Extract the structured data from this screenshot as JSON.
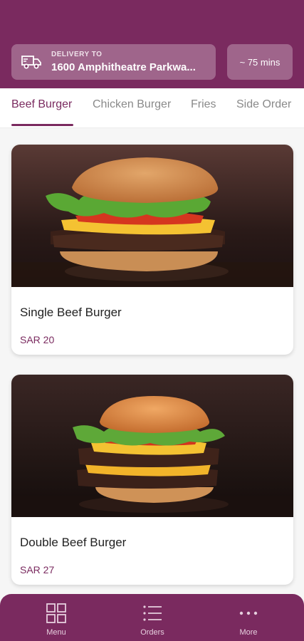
{
  "header": {
    "delivery_label": "DELIVERY TO",
    "delivery_address": "1600 Amphitheatre Parkwa...",
    "eta": "~ 75 mins",
    "icon": "truck-icon"
  },
  "tabs": [
    {
      "label": "Beef Burger",
      "active": true
    },
    {
      "label": "Chicken Burger",
      "active": false
    },
    {
      "label": "Fries",
      "active": false
    },
    {
      "label": "Side Order",
      "active": false
    }
  ],
  "products": [
    {
      "name": "Single Beef Burger",
      "price": "SAR 20"
    },
    {
      "name": "Double Beef Burger",
      "price": "SAR 27"
    }
  ],
  "bottom_nav": [
    {
      "label": "Menu",
      "icon": "grid-icon"
    },
    {
      "label": "Orders",
      "icon": "list-icon"
    },
    {
      "label": "More",
      "icon": "more-dots-icon"
    }
  ],
  "colors": {
    "brand": "#7a2a5f",
    "background": "#f6f6f6"
  }
}
